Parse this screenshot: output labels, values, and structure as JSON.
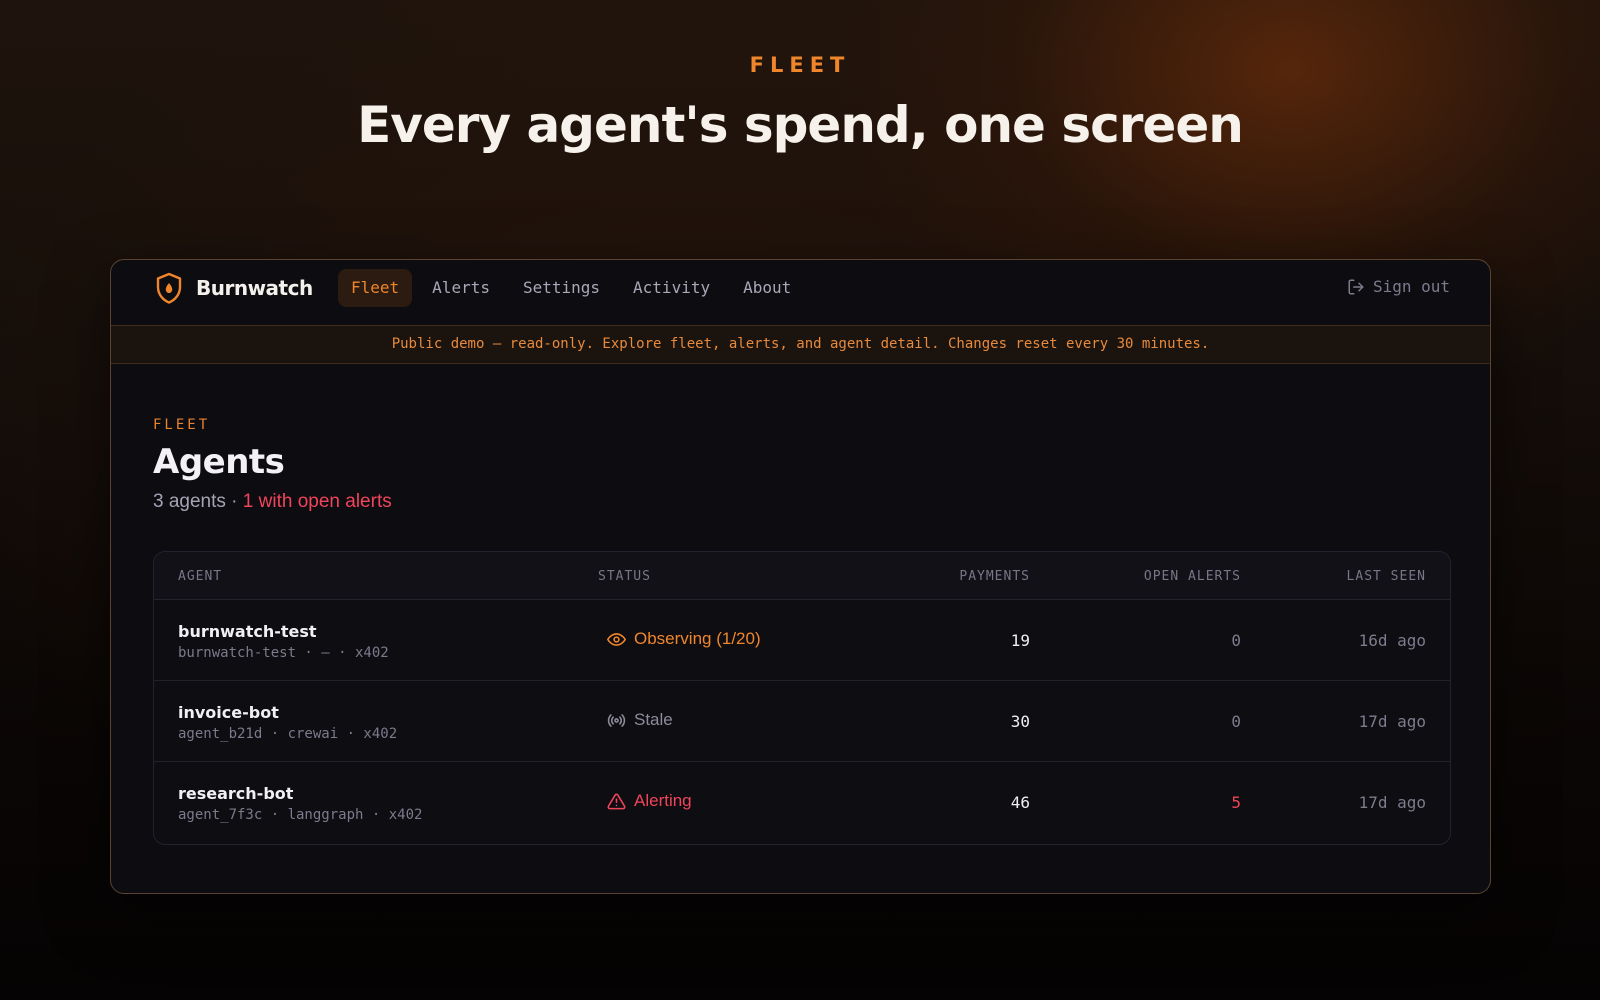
{
  "hero": {
    "eyebrow": "FLEET",
    "title": "Every agent's spend, one screen"
  },
  "app": {
    "brand": "Burnwatch",
    "brand_icon": "shield-flame-icon",
    "nav": [
      {
        "label": "Fleet",
        "active": true
      },
      {
        "label": "Alerts",
        "active": false
      },
      {
        "label": "Settings",
        "active": false
      },
      {
        "label": "Activity",
        "active": false
      },
      {
        "label": "About",
        "active": false
      }
    ],
    "signout": {
      "label": "Sign out",
      "icon": "sign-out-icon"
    },
    "banner": "Public demo — read-only. Explore fleet, alerts, and agent detail. Changes reset every 30 minutes."
  },
  "page": {
    "eyebrow": "FLEET",
    "title": "Agents",
    "summary_count": "3 agents",
    "summary_sep": " · ",
    "summary_alerts": "1 with open alerts"
  },
  "table": {
    "columns": {
      "agent": "AGENT",
      "status": "STATUS",
      "payments": "PAYMENTS",
      "open_alerts": "OPEN ALERTS",
      "last_seen": "LAST SEEN"
    },
    "rows": [
      {
        "name": "burnwatch-test",
        "meta": "burnwatch-test · — · x402",
        "status": "Observing (1/20)",
        "status_icon": "eye-icon",
        "payments": "19",
        "open_alerts": "0",
        "last_seen": "16d ago"
      },
      {
        "name": "invoice-bot",
        "meta": "agent_b21d · crewai · x402",
        "status": "Stale",
        "status_icon": "broadcast-icon",
        "payments": "30",
        "open_alerts": "0",
        "last_seen": "17d ago"
      },
      {
        "name": "research-bot",
        "meta": "agent_7f3c · langgraph · x402",
        "status": "Alerting",
        "status_icon": "warning-triangle-icon",
        "payments": "46",
        "open_alerts": "5",
        "last_seen": "17d ago"
      }
    ]
  },
  "colors": {
    "accent": "#f0862c",
    "danger": "#f0445a",
    "muted": "#7e7b8c",
    "panel": "#0c0c11"
  }
}
